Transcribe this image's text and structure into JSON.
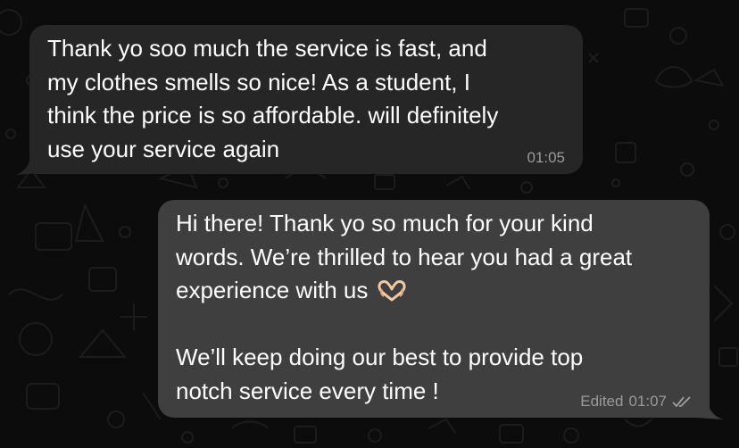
{
  "conversation": {
    "incoming": {
      "text": "Thank yo soo much the service is fast, and\nmy clothes smells so nice! As a student, I\nthink the price is so affordable. will definitely\nuse your service again",
      "time": "01:05"
    },
    "outgoing": {
      "text_part1": "Hi there! Thank yo so much for your kind\nwords. We’re thrilled to hear you had a great\nexperience with us ",
      "emoji": "heart-hands-emoji",
      "text_part2": "\n\nWe’ll keep doing our best to provide top\nnotch service every time !",
      "edited_label": "Edited",
      "time": "01:07",
      "status_icon": "double-check-read-icon"
    }
  },
  "colors": {
    "background": "#0c0c0c",
    "incoming_bubble": "#262626",
    "outgoing_bubble": "#3f3f3f",
    "text": "#ffffff",
    "meta_text": "#9a9a9a"
  }
}
